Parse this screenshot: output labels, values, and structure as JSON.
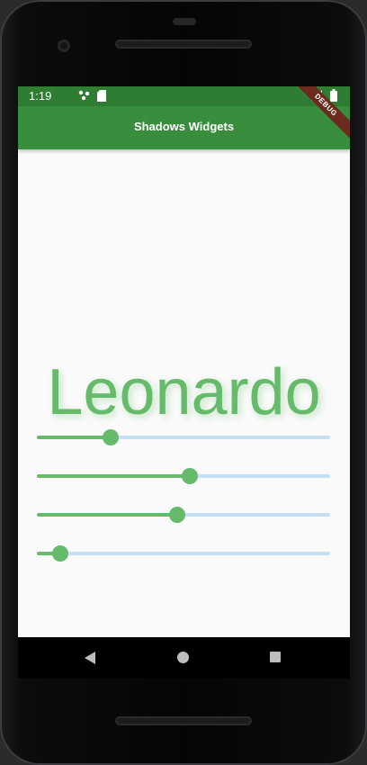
{
  "status_bar": {
    "time": "1:19",
    "icons": [
      "notification-dots-icon",
      "sd-card-icon",
      "signal-icon",
      "battery-icon"
    ]
  },
  "app_bar": {
    "title": "Shadows Widgets",
    "debug_banner": "DEBUG"
  },
  "main": {
    "display_text": "Leonardo",
    "text_color": "#66bb6a",
    "sliders": [
      {
        "name": "slider-1",
        "value_fraction": 0.25
      },
      {
        "name": "slider-2",
        "value_fraction": 0.52
      },
      {
        "name": "slider-3",
        "value_fraction": 0.48
      },
      {
        "name": "slider-4",
        "value_fraction": 0.08
      }
    ]
  },
  "colors": {
    "primary": "#388e3c",
    "status": "#2e7d32",
    "accent": "#66bb6a",
    "inactive_track": "#c5dff5"
  },
  "nav_bar": {
    "buttons": [
      "back-icon",
      "home-icon",
      "recents-icon"
    ]
  }
}
